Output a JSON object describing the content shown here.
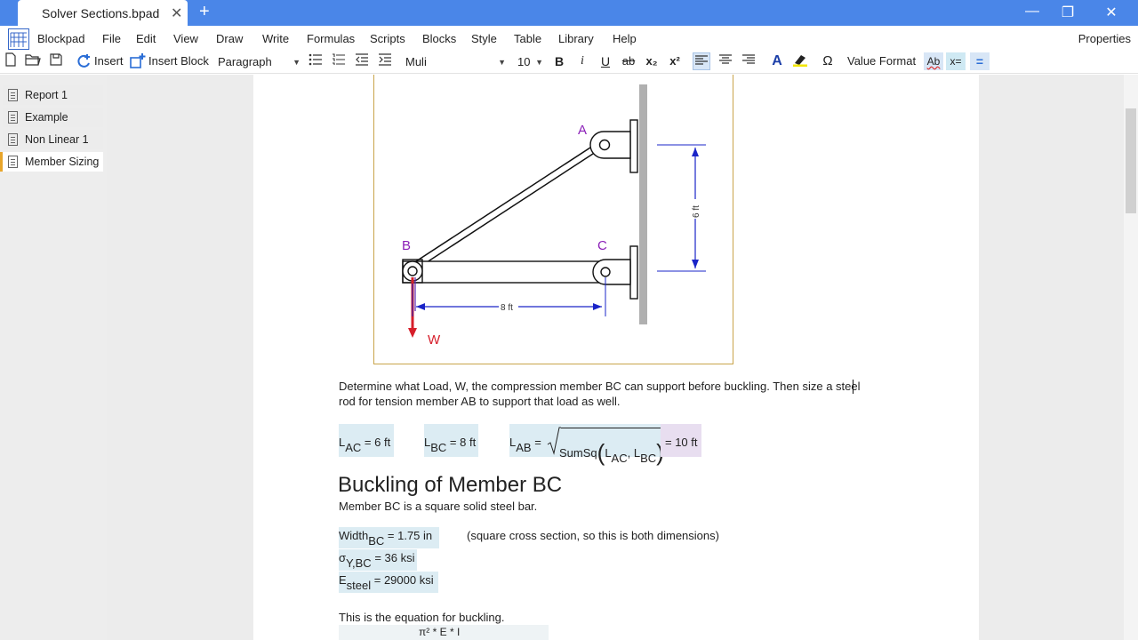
{
  "window": {
    "tab_title": "Solver Sections.bpad",
    "new_tab_icon": "+",
    "minimize_icon": "—",
    "restore_icon": "❐",
    "close_icon": "✕"
  },
  "menu": {
    "app_name": "Blockpad",
    "items": [
      "File",
      "Edit",
      "View",
      "Draw",
      "Write",
      "Formulas",
      "Scripts",
      "Blocks",
      "Style",
      "Table",
      "Library",
      "Help"
    ],
    "properties": "Properties"
  },
  "toolbar": {
    "insert": "Insert",
    "insert_block": "Insert Block",
    "paragraph_style": "Paragraph",
    "font": "Muli",
    "font_size": "10",
    "bold": "B",
    "italic": "i",
    "underline": "U",
    "strike": "ab",
    "subscript": "x₂",
    "superscript": "x²",
    "value_format": "Value Format",
    "ab_label": "Ab",
    "xeq_label": "x=",
    "eq_label": "=",
    "omega": "Ω"
  },
  "documents": [
    {
      "label": "Report 1",
      "active": false
    },
    {
      "label": "Example",
      "active": false
    },
    {
      "label": "Non Linear 1",
      "active": false
    },
    {
      "label": "Member Sizing",
      "active": true
    }
  ],
  "diagram": {
    "label_a": "A",
    "label_b": "B",
    "label_c": "C",
    "label_w": "W",
    "dim_horizontal": "8 ft",
    "dim_vertical": "6 ft"
  },
  "content": {
    "problem_line1": "Determine what Load, W, the compression member BC can support before buckling. Then size a steel",
    "problem_line2": "rod for tension member AB to support that load as well.",
    "lac": {
      "var": "L",
      "sub": "AC",
      "rhs": " = 6 ft"
    },
    "lbc": {
      "var": "L",
      "sub": "BC",
      "rhs": " = 8 ft"
    },
    "lab": {
      "var": "L",
      "sub": "AB",
      "eq": " = ",
      "func": "SumSq",
      "arg1": "L",
      "arg1_sub": "AC",
      "arg2": "L",
      "arg2_sub": "BC",
      "result": "= 10 ft"
    },
    "heading": "Buckling of Member BC",
    "desc": "Member BC is a square solid steel bar.",
    "width": {
      "var": "Width",
      "sub": "BC",
      "rhs": " = 1.75 in"
    },
    "width_note": "(square cross section, so this is both dimensions)",
    "sigma": {
      "var": "σ",
      "sub": "Y,BC",
      "rhs": " = 36 ksi"
    },
    "esteel": {
      "var": "E",
      "sub": "steel",
      "rhs": " = 29000 ksi"
    },
    "eq_intro": "This is the equation for buckling.",
    "eq_partial": "π² * E * I"
  }
}
